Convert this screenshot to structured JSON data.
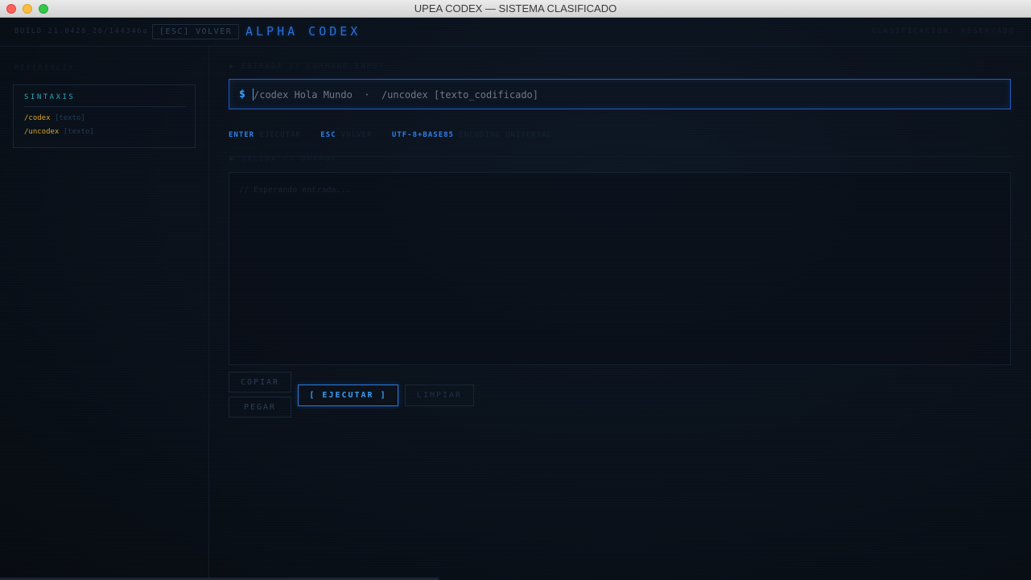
{
  "window": {
    "title": "UPEA CODEX — SISTEMA CLASIFICADO"
  },
  "topbar": {
    "build": "BUILD 21.0428_26/144346a",
    "esc_button": "[ESC] VOLVER",
    "brand": "ALPHA CODEX",
    "classification": "CLASIFICACIÓN: RESERVADO"
  },
  "sidebar": {
    "section_label": "REFERENCIA",
    "syntax": {
      "title": "SINTAXIS",
      "rows": [
        {
          "cmd": "/codex",
          "arg": "[texto]"
        },
        {
          "cmd": "/uncodex",
          "arg": "[texto]"
        }
      ]
    }
  },
  "input_section": {
    "label": "▶ ENTRADA // COMMAND INPUT",
    "prompt": "$",
    "value": "",
    "placeholder": "/codex Hola Mundo  ·  /uncodex [texto_codificado]",
    "hints": [
      {
        "key": "ENTER",
        "desc": "EJECUTAR"
      },
      {
        "key": "ESC",
        "desc": "VOLVER"
      },
      {
        "key": "UTF-8+BASE85",
        "desc": "ENCODING UNIVERSAL"
      }
    ]
  },
  "output_section": {
    "label": "▶ SALIDA // OUTPUT",
    "placeholder": "// Esperando entrada..."
  },
  "buttons": {
    "copy": "COPIAR",
    "paste": "PEGAR",
    "execute": "[ EJECUTAR ]",
    "clear": "LIMPIAR"
  },
  "colors": {
    "accent": "#2a6fd6",
    "syntax_command": "#d9a520",
    "syntax_title": "#2ba6b8"
  }
}
